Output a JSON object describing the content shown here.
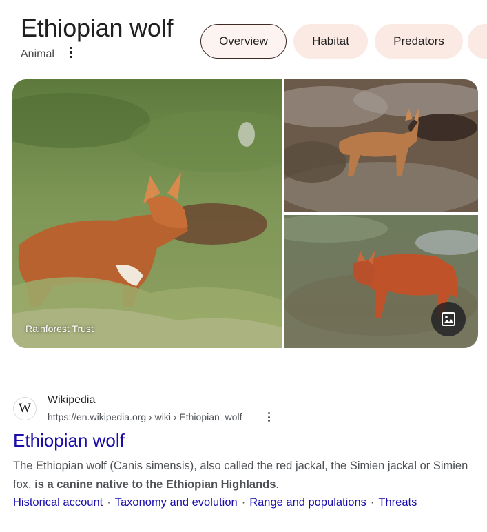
{
  "knowledge_panel": {
    "title": "Ethiopian wolf",
    "subtitle": "Animal",
    "more_icon": "more-vert-icon",
    "chips": [
      {
        "label": "Overview",
        "selected": true
      },
      {
        "label": "Habitat",
        "selected": false
      },
      {
        "label": "Predators",
        "selected": false
      },
      {
        "label": "",
        "selected": false
      }
    ]
  },
  "gallery": {
    "main_credit": "Rainforest Trust",
    "images_button_icon": "image-icon"
  },
  "result": {
    "site_name": "Wikipedia",
    "favicon_letter": "W",
    "url": "https://en.wikipedia.org › wiki › Ethiopian_wolf",
    "title": "Ethiopian wolf",
    "snippet_plain": "The Ethiopian wolf (Canis simensis), also called the red jackal, the Simien jackal or Simien fox, ",
    "snippet_bold": "is a canine native to the Ethiopian Highlands",
    "snippet_end": ".",
    "sitelinks": [
      "Historical account",
      "Taxonomy and evolution",
      "Range and populations",
      "Threats"
    ]
  },
  "colors": {
    "chip_bg": "#fbe9e4",
    "link": "#1a0dab",
    "divider": "#ecd3cc"
  }
}
